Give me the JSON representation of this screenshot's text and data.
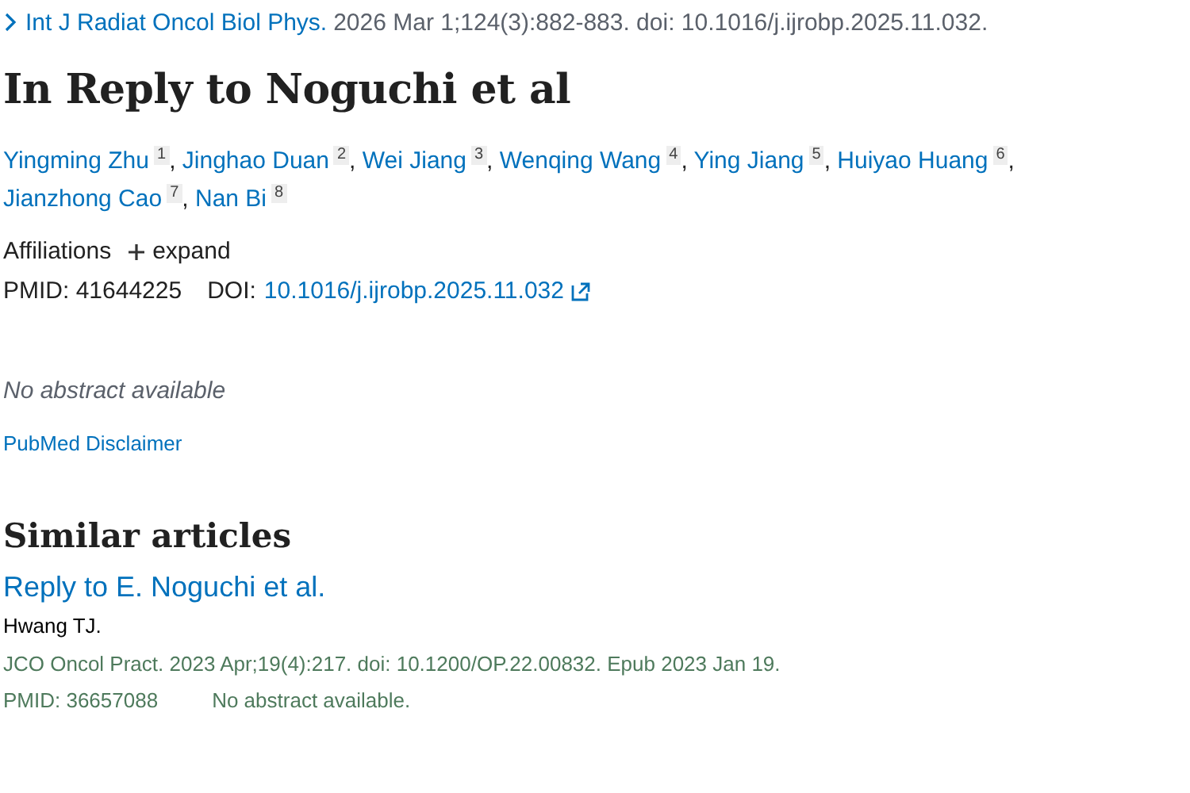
{
  "citation": {
    "journal": "Int J Radiat Oncol Biol Phys.",
    "details": "2026 Mar 1;124(3):882-883. doi: 10.1016/j.ijrobp.2025.11.032."
  },
  "title": "In Reply to Noguchi et al",
  "authors": [
    {
      "name": "Yingming Zhu",
      "affiliation": "1",
      "separator": ","
    },
    {
      "name": "Jinghao Duan",
      "affiliation": "2",
      "separator": ","
    },
    {
      "name": "Wei Jiang",
      "affiliation": "3",
      "separator": ","
    },
    {
      "name": "Wenqing Wang",
      "affiliation": "4",
      "separator": ","
    },
    {
      "name": "Ying Jiang",
      "affiliation": "5",
      "separator": ","
    },
    {
      "name": "Huiyao Huang",
      "affiliation": "6",
      "separator": ","
    },
    {
      "name": "Jianzhong Cao",
      "affiliation": "7",
      "separator": ","
    },
    {
      "name": "Nan Bi",
      "affiliation": "8"
    }
  ],
  "affiliations": {
    "label": "Affiliations",
    "toggle": "expand",
    "expanded": false
  },
  "identifiers": {
    "pmid": "PMID: 41644225",
    "doi_label": "DOI:",
    "doi": "10.1016/j.ijrobp.2025.11.032"
  },
  "abstract": "No abstract available",
  "disclaimer": "PubMed Disclaimer",
  "similar": {
    "heading": "Similar articles",
    "items": [
      {
        "title": "Reply to E. Noguchi et al.",
        "authors": "Hwang TJ.",
        "citation": "JCO Oncol Pract. 2023 Apr;19(4):217. doi: 10.1200/OP.22.00832. Epub 2023 Jan 19.",
        "pmid": "PMID: 36657088",
        "note": "No abstract available."
      }
    ]
  }
}
